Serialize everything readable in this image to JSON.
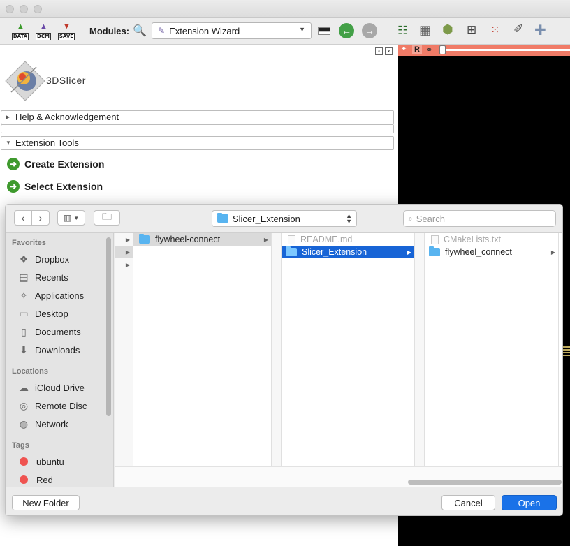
{
  "toolbar": {
    "data_label": "DATA",
    "dcm_label": "DCM",
    "save_label": "SAVE",
    "modules_label": "Modules:",
    "module_selected": "Extension Wizard"
  },
  "logo_text": "3DSlicer",
  "sections": {
    "help": "Help & Acknowledgement",
    "extension_tools": "Extension Tools"
  },
  "actions": {
    "create": "Create Extension",
    "select": "Select Extension"
  },
  "viewer": {
    "orientation": "R",
    "color": "#f07b67"
  },
  "dialog": {
    "path": "Slicer_Extension",
    "search_placeholder": "Search",
    "sidebar": {
      "favorites_heading": "Favorites",
      "favorites": [
        {
          "label": "Dropbox",
          "icon": "dropbox-icon"
        },
        {
          "label": "Recents",
          "icon": "recents-icon"
        },
        {
          "label": "Applications",
          "icon": "applications-icon"
        },
        {
          "label": "Desktop",
          "icon": "desktop-icon"
        },
        {
          "label": "Documents",
          "icon": "documents-icon"
        },
        {
          "label": "Downloads",
          "icon": "downloads-icon"
        }
      ],
      "locations_heading": "Locations",
      "locations": [
        {
          "label": "iCloud Drive",
          "icon": "icloud-icon"
        },
        {
          "label": "Remote Disc",
          "icon": "disc-icon"
        },
        {
          "label": "Network",
          "icon": "network-icon"
        }
      ],
      "tags_heading": "Tags",
      "tags": [
        {
          "label": "ubuntu",
          "color": "#ef5350"
        },
        {
          "label": "Red",
          "color": "#ef5350"
        }
      ]
    },
    "columns": {
      "col2": [
        "flywheel-connect"
      ],
      "col3": [
        "README.md",
        "Slicer_Extension"
      ],
      "col4": [
        "CMakeLists.txt",
        "flywheel_connect"
      ]
    },
    "new_folder": "New Folder",
    "cancel": "Cancel",
    "open": "Open",
    "accent": "#1a72e8"
  }
}
